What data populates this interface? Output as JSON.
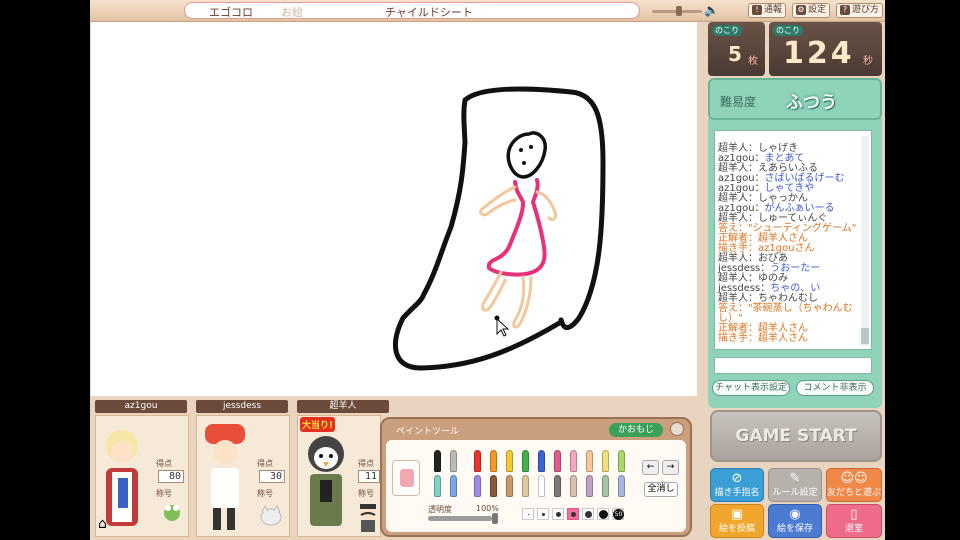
{
  "window": {
    "app_name": "エゴコロ",
    "sub_label": "お絵",
    "room_name": "チャイルドシート"
  },
  "top_buttons": {
    "report": "通報",
    "settings": "設定",
    "howto": "遊び方"
  },
  "counters": {
    "remaining_sheets_label": "のこり",
    "remaining_sheets_value": "5",
    "remaining_sheets_unit": "枚",
    "remaining_time_label": "のこり",
    "remaining_time_value": "124",
    "remaining_time_unit": "秒"
  },
  "difficulty": {
    "label": "難易度",
    "value": "ふつう"
  },
  "chat": {
    "lines": [
      {
        "name": "超羊人",
        "msg": "しゃげき",
        "style": "normal"
      },
      {
        "name": "az1gou",
        "msg": "まとあて",
        "style": "blue"
      },
      {
        "name": "超羊人",
        "msg": "えあらいふる",
        "style": "normal"
      },
      {
        "name": "az1gou",
        "msg": "さばいばるげーむ",
        "style": "blue"
      },
      {
        "name": "az1gou",
        "msg": "しゃてきや",
        "style": "blue"
      },
      {
        "name": "超羊人",
        "msg": "しゃっかん",
        "style": "normal"
      },
      {
        "name": "az1gou",
        "msg": "がんふぁいーる",
        "style": "blue"
      },
      {
        "name": "超羊人",
        "msg": "しゅーてぃんぐ",
        "style": "normal"
      },
      {
        "name": "答え",
        "msg": "\"シューティングゲーム\"",
        "style": "orange"
      },
      {
        "name": "正解者",
        "msg": "超羊人さん",
        "style": "orange"
      },
      {
        "name": "描き手",
        "msg": "az1gouさん",
        "style": "orange"
      },
      {
        "name": "超羊人",
        "msg": "おびあ",
        "style": "normal"
      },
      {
        "name": "jessdess",
        "msg": "うおーたー",
        "style": "blue"
      },
      {
        "name": "超羊人",
        "msg": "ゆのみ",
        "style": "normal"
      },
      {
        "name": "jessdess",
        "msg": "ちゃの、い",
        "style": "blue"
      },
      {
        "name": "超羊人",
        "msg": "ちゃわんむし",
        "style": "normal"
      },
      {
        "name": "答え",
        "msg": "\"茶碗蒸し（ちゃわんむ",
        "style": "orange"
      },
      {
        "name": "",
        "msg": "し）\"",
        "style": "orange"
      },
      {
        "name": "正解者",
        "msg": "超羊人さん",
        "style": "orange"
      },
      {
        "name": "描き手",
        "msg": "超羊人さん",
        "style": "orange"
      }
    ],
    "input_value": "",
    "display_settings_label": "チャット表示設定",
    "hide_comments_label": "コメント非表示"
  },
  "game_start_label": "GAME START",
  "action_buttons": {
    "drawer_nomination": "描き手指名",
    "rule_settings": "ルール設定",
    "invite_friends": "友だちと遊ぶ",
    "post_drawing": "絵を投稿",
    "save_drawing": "絵を保存",
    "leave_room": "退室"
  },
  "players": [
    {
      "name": "az1gou",
      "score_label": "得点",
      "score": "80",
      "title_label": "称号"
    },
    {
      "name": "jessdess",
      "score_label": "得点",
      "score": "30",
      "title_label": "称号"
    },
    {
      "name": "超羊人",
      "score_label": "得点",
      "score": "11",
      "title_label": "称号",
      "badge": "大当り!"
    }
  ],
  "paint_tool": {
    "title": "ペイントツール",
    "face_button": "かおもじ",
    "opacity_label": "透明度",
    "opacity_value": "100%",
    "opacity_fraction": 1.0,
    "clear_all_label": "全消し",
    "colors": [
      "#222222",
      "#bbbbbb",
      "#e8322c",
      "#f39a26",
      "#f4c932",
      "#3fb24b",
      "#3a63d8",
      "#e05a8e",
      "#f5a7c0",
      "#f7c79a",
      "#f1e07a",
      "#a8d96a",
      "#7fd2c6",
      "#7da8e8",
      "#9f8ce0",
      "#8a5a3a",
      "#c89a6a",
      "#e3c9a3",
      "#ffffff",
      "#7a7a7a",
      "#d9c1ad",
      "#c2a1c9",
      "#a3c7a3",
      "#a7b7e3"
    ],
    "size_label": "50"
  }
}
